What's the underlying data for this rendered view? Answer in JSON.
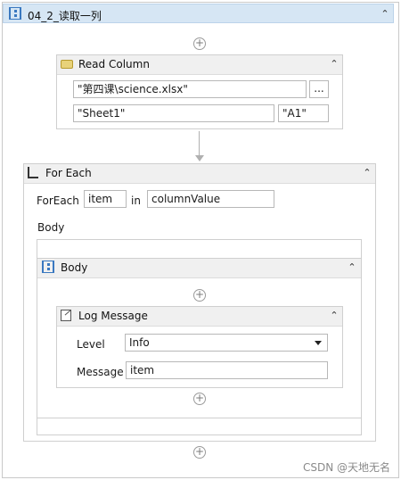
{
  "sequence": {
    "title": "04_2_读取一列",
    "collapse_glyph": "⌃",
    "icon": "sequence-icon"
  },
  "plus_glyph": "+",
  "read_column": {
    "title": "Read Column",
    "icon": "read-column-icon",
    "collapse_glyph": "⌃",
    "workbook_path": "\"第四课\\science.xlsx\"",
    "browse_label": "...",
    "sheet_name": "\"Sheet1\"",
    "start_cell": "\"A1\""
  },
  "for_each": {
    "title": "For Each",
    "icon": "for-each-icon",
    "collapse_glyph": "⌃",
    "foreach_label": "ForEach",
    "item_value": "item",
    "in_label": "in",
    "collection_value": "columnValue",
    "body_label": "Body"
  },
  "body_sequence": {
    "title": "Body",
    "icon": "sequence-icon",
    "collapse_glyph": "⌃"
  },
  "log_message": {
    "title": "Log Message",
    "icon": "log-message-icon",
    "collapse_glyph": "⌃",
    "level_label": "Level",
    "level_value": "Info",
    "message_label": "Message",
    "message_value": "item"
  },
  "watermark": "CSDN @天地无名"
}
